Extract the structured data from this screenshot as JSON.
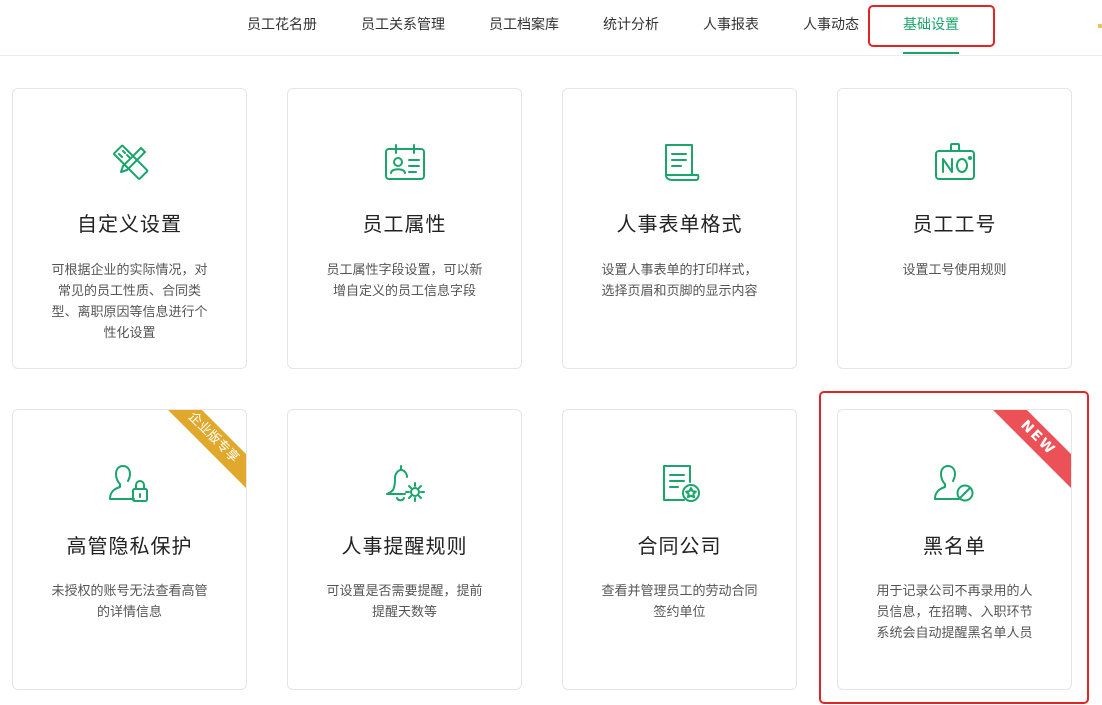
{
  "nav": {
    "tabs": [
      {
        "label": "员工花名册",
        "active": false
      },
      {
        "label": "员工关系管理",
        "active": false
      },
      {
        "label": "员工档案库",
        "active": false
      },
      {
        "label": "统计分析",
        "active": false
      },
      {
        "label": "人事报表",
        "active": false
      },
      {
        "label": "人事动态",
        "active": false
      },
      {
        "label": "基础设置",
        "active": true
      }
    ]
  },
  "colors": {
    "accent": "#1aa56b",
    "highlight": "#e42424",
    "badge_gold": "#e0a92c",
    "badge_red": "#ec5157"
  },
  "cards": [
    {
      "title": "自定义设置",
      "icon": "pencil-ruler-icon",
      "desc": "可根据企业的实际情况，对常见的员工性质、合同类型、离职原因等信息进行个性化设置"
    },
    {
      "title": "员工属性",
      "icon": "employee-card-icon",
      "desc": "员工属性字段设置，可以新增自定义的员工信息字段"
    },
    {
      "title": "人事表单格式",
      "icon": "document-scroll-icon",
      "desc": "设置人事表单的打印样式，选择页眉和页脚的显示内容"
    },
    {
      "title": "员工工号",
      "icon": "id-number-icon",
      "desc": "设置工号使用规则"
    },
    {
      "title": "高管隐私保护",
      "icon": "user-lock-icon",
      "desc": "未授权的账号无法查看高管的详情信息",
      "badge": "企业版专享"
    },
    {
      "title": "人事提醒规则",
      "icon": "bell-gear-icon",
      "desc": "可设置是否需要提醒，提前提醒天数等"
    },
    {
      "title": "合同公司",
      "icon": "contract-star-icon",
      "desc": "查看并管理员工的劳动合同签约单位"
    },
    {
      "title": "黑名单",
      "icon": "user-block-icon",
      "desc": "用于记录公司不再录用的人员信息，在招聘、入职环节系统会自动提醒黑名单人员",
      "badge": "NEW"
    }
  ]
}
